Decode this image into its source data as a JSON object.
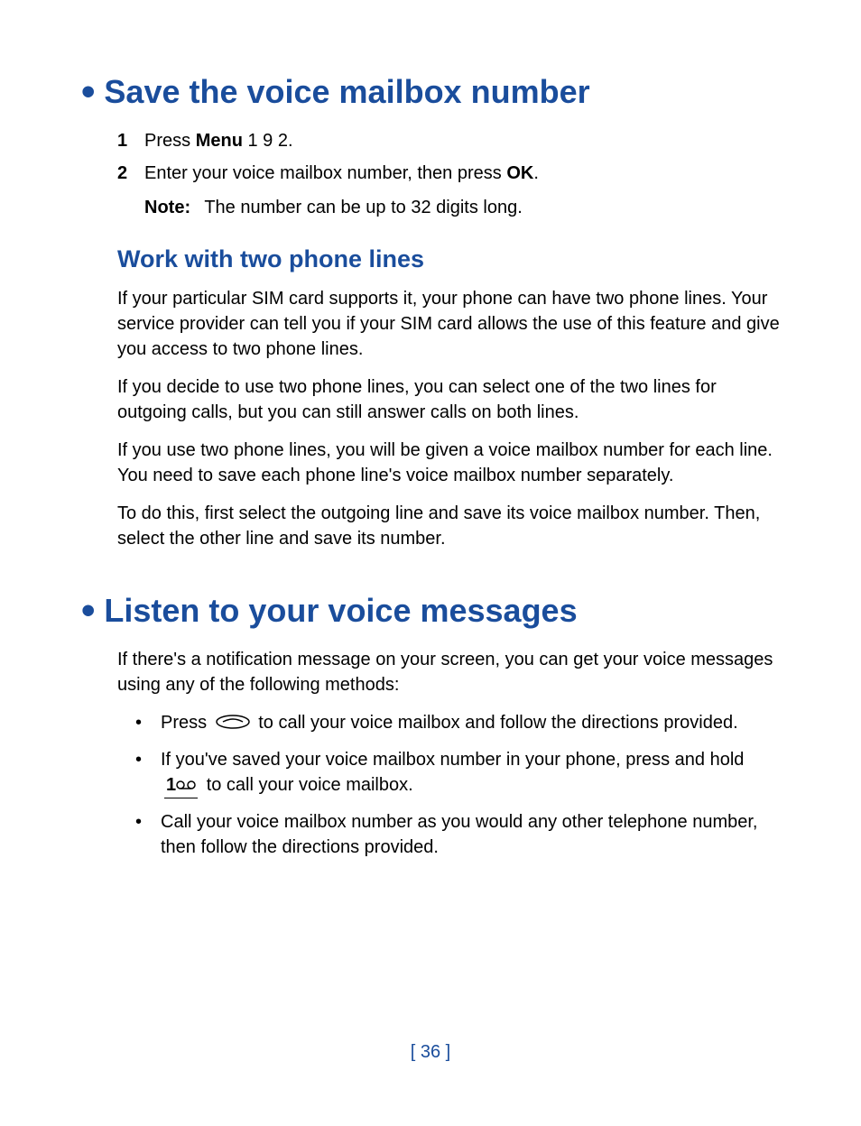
{
  "heading1": {
    "title": "Save the voice mailbox number"
  },
  "steps": [
    {
      "num": "1",
      "prefix": "Press ",
      "bold": "Menu",
      "suffix": " 1 9 2."
    },
    {
      "num": "2",
      "prefix": "Enter your voice mailbox number, then press ",
      "bold": "OK",
      "suffix": "."
    }
  ],
  "note": {
    "label": "Note:",
    "text": "The number can be up to 32 digits long."
  },
  "heading2": {
    "title": "Work with two phone lines"
  },
  "paragraphs": [
    "If your particular SIM card supports it, your phone can have two phone lines. Your service provider can tell you if your SIM card allows the use of this feature and give you access to two phone lines.",
    "If you decide to use two phone lines, you can select one of the two lines for outgoing calls, but you can still answer calls on both lines.",
    "If you use two phone lines, you will be given a voice mailbox number for each line. You need to save each phone line's voice mailbox number separately.",
    "To do this, first select the outgoing line and save its voice mailbox number. Then, select the other line and save its number."
  ],
  "heading3": {
    "title": "Listen to your voice messages"
  },
  "intro": "If there's a notification message on your screen, you can get your voice messages using any of the following methods:",
  "bullets": {
    "b1_prefix": "Press ",
    "b1_suffix": " to call your voice mailbox and follow the directions provided.",
    "b2_prefix": "If you've saved your voice mailbox number in your phone, press and hold ",
    "b2_key": "1",
    "b2_suffix": " to call your voice mailbox.",
    "b3": "Call your voice mailbox number as you would any other telephone number, then follow the directions provided."
  },
  "page_number": "[ 36 ]"
}
